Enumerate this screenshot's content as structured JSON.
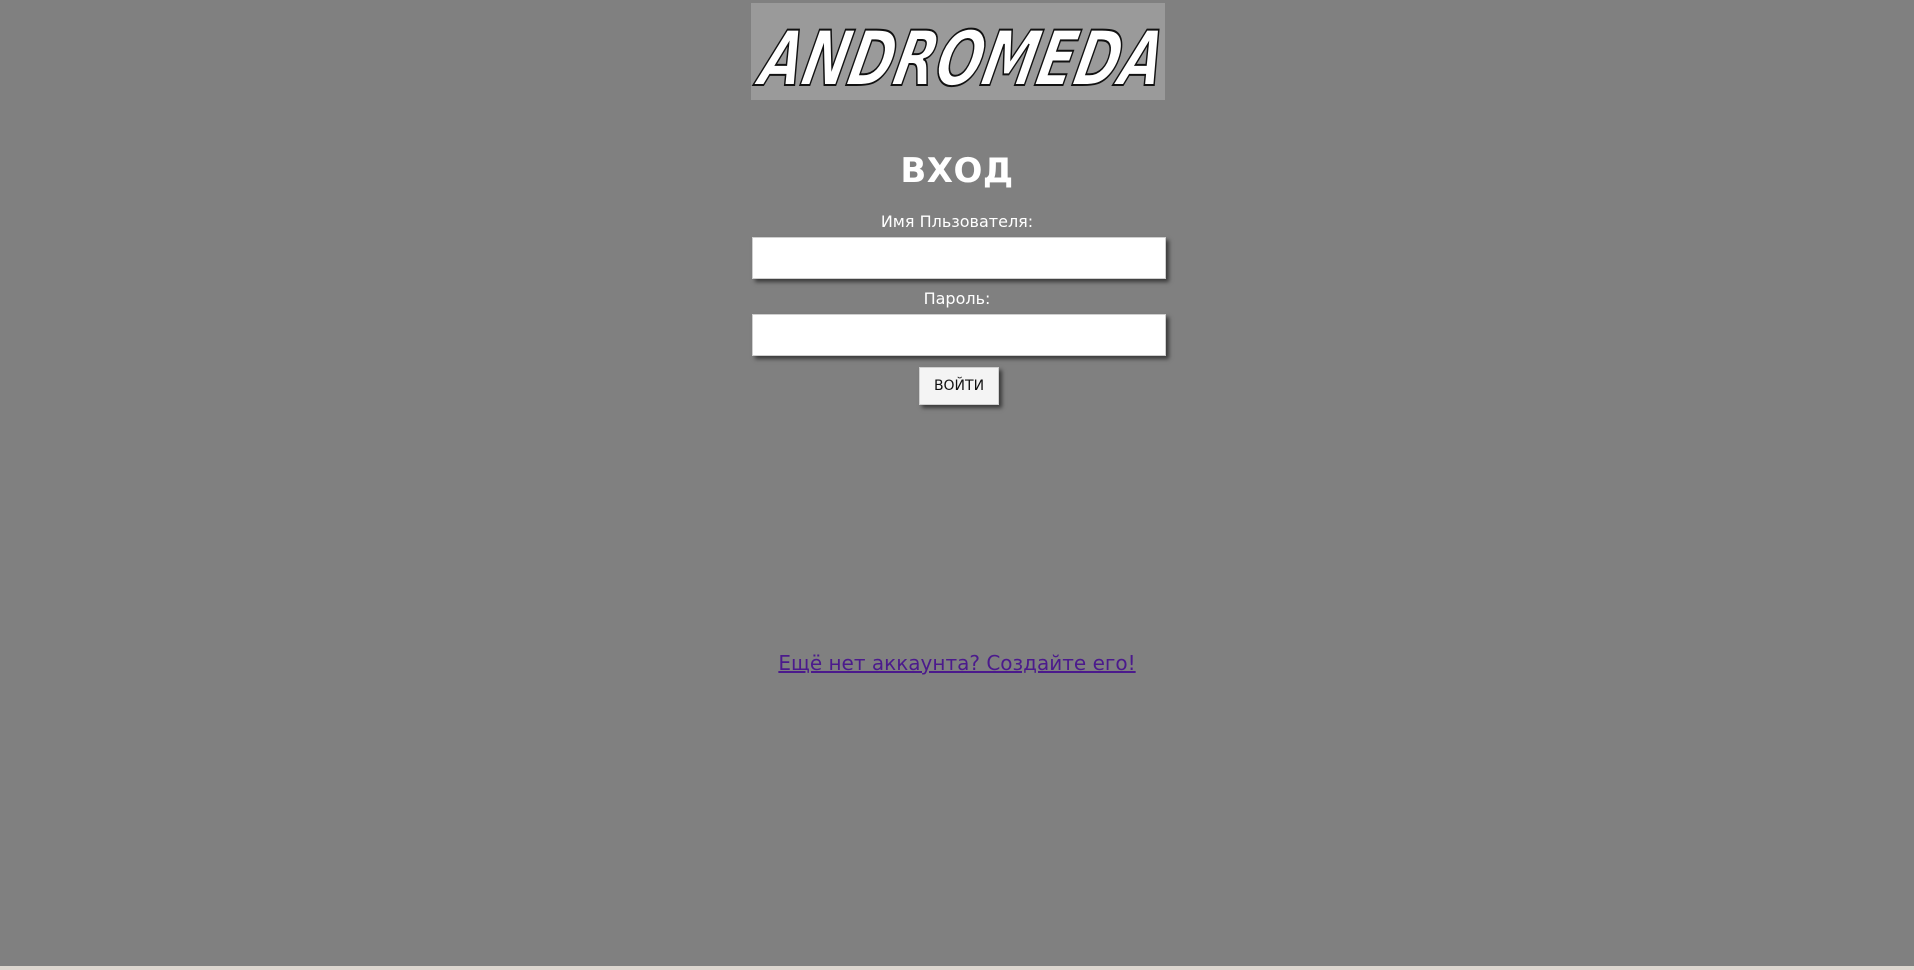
{
  "logo": {
    "text": "ANDROMEDA"
  },
  "login": {
    "title": "ВХОД",
    "username_label": "Имя Пльзователя:",
    "username_value": "",
    "password_label": "Пароль:",
    "password_value": "",
    "submit_label": "ВОЙТИ"
  },
  "signup": {
    "link_text": "Ещё нет аккаунта? Создайте его!"
  },
  "colors": {
    "background": "#808080",
    "logo_background": "#9a9a9a",
    "link": "#4b1a8c",
    "text": "#ffffff"
  }
}
